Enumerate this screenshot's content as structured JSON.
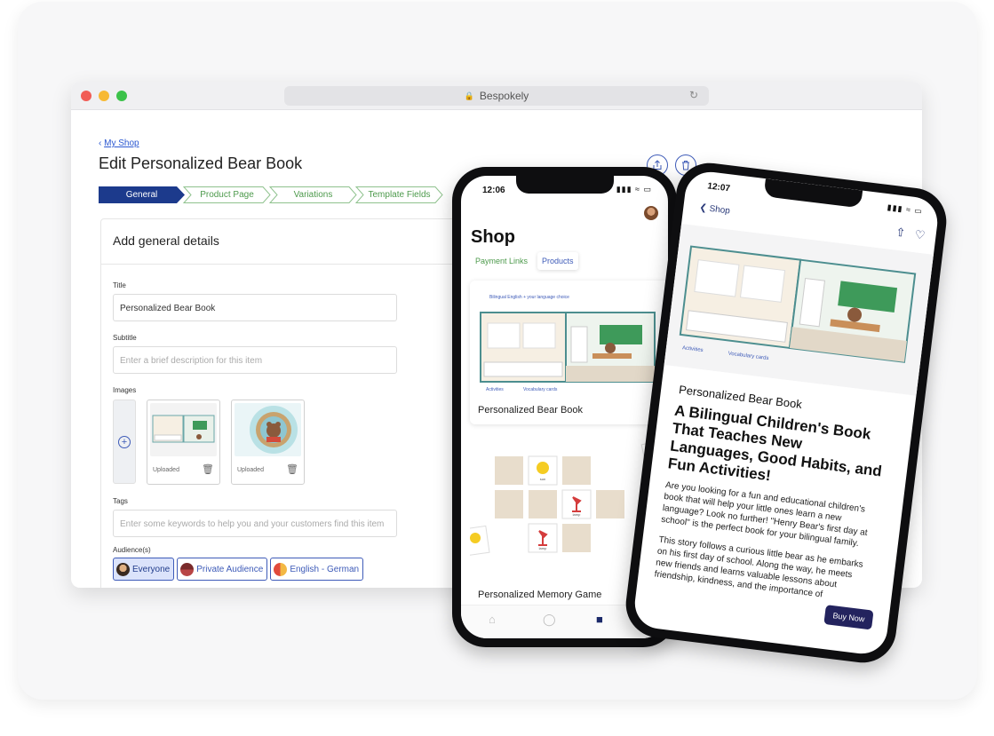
{
  "browser": {
    "url_label": "Bespokely",
    "breadcrumb": "My Shop",
    "page_title": "Edit Personalized Bear Book",
    "steps": [
      "General",
      "Product Page",
      "Variations",
      "Template Fields"
    ],
    "panel_title": "Add general details",
    "fields": {
      "title_label": "Title",
      "title_value": "Personalized Bear Book",
      "subtitle_label": "Subtitle",
      "subtitle_placeholder": "Enter a brief description for this item",
      "images_label": "Images",
      "uploaded_1": "Uploaded",
      "uploaded_2": "Uploaded",
      "tags_label": "Tags",
      "tags_placeholder": "Enter some keywords to help you and your customers find this item",
      "audience_label": "Audience(s)"
    },
    "audiences": [
      "Everyone",
      "Private Audience",
      "English - German"
    ]
  },
  "shop_phone": {
    "time": "12:06",
    "title": "Shop",
    "tabs": [
      "Payment Links",
      "Products"
    ],
    "products": [
      "Personalized Bear Book",
      "Personalized Memory Game"
    ],
    "card_caption_top": "Bilingual English + your language choice",
    "card_caption_activities": "Activities",
    "card_caption_vocab": "Vocabulary cards",
    "memory_cards": [
      "sun",
      "lamp",
      "lamp"
    ]
  },
  "detail_phone": {
    "time": "12:07",
    "back_label": "Shop",
    "subtitle": "Personalized Bear Book",
    "headline": "A Bilingual Children's Book That Teaches New Languages, Good Habits, and Fun Activities!",
    "body_1": "Are you looking for a fun and educational children's book that will help your little ones learn a new language? Look no further! \"Henry Bear's first day at school\" is the perfect book for your bilingual family.",
    "body_2": "This story follows a curious little bear as he embarks on his first day of school. Along the way, he meets new friends and learns valuable lessons about friendship, kindness, and the importance of",
    "buy_label": "Buy Now",
    "hero_caption_activities": "Activities",
    "hero_caption_vocab": "Vocabulary cards"
  },
  "colors": {
    "brand_navy": "#1c3a8c",
    "step_green": "#4d9a4c",
    "accent_blue": "#3e5bb8"
  }
}
